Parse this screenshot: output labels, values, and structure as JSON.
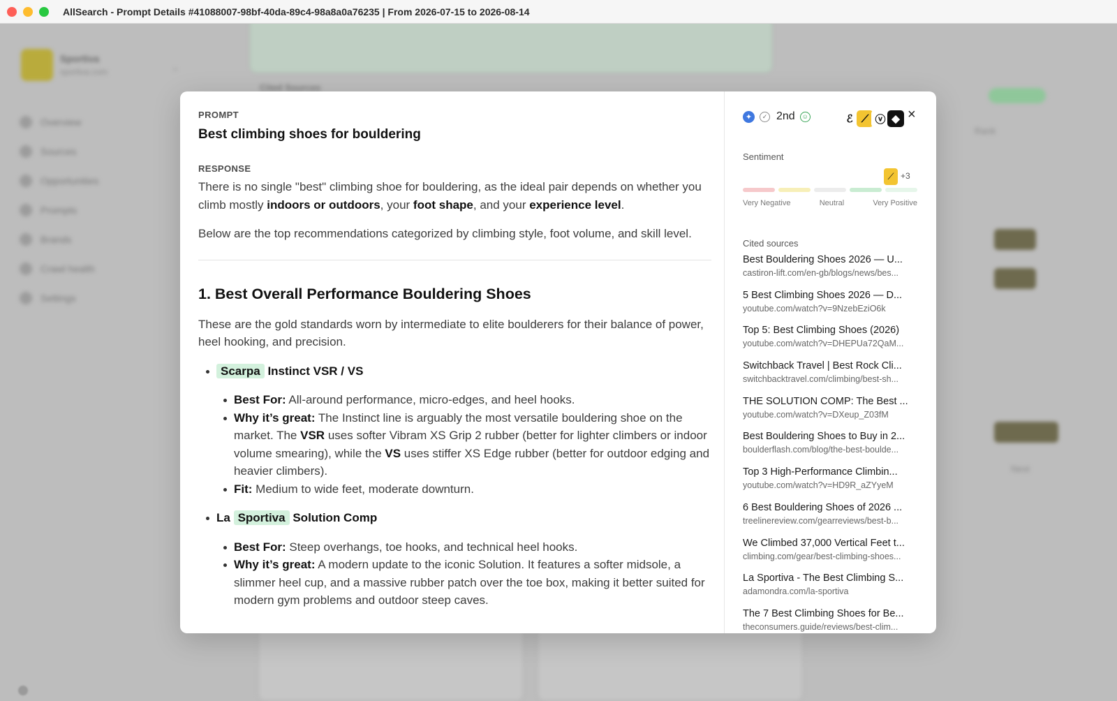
{
  "window": {
    "title": "AllSearch - Prompt Details #41088007-98bf-40da-89c4-98a8a0a76235 | From 2026-07-15 to 2026-08-14"
  },
  "background": {
    "brand_name": "Sportiva",
    "brand_sub": "sportiva.com",
    "nav": [
      "Overview",
      "Sources",
      "Opportunities",
      "Prompts",
      "Brands",
      "Crawl health",
      "Settings"
    ],
    "cited_heading": "Cited Sources",
    "rank_col": "Rank",
    "next": "Next"
  },
  "prompt": {
    "label": "PROMPT",
    "text": "Best climbing shoes for bouldering"
  },
  "response": {
    "label": "RESPONSE",
    "p1": [
      "There is no single \"best\" climbing shoe for bouldering, as the ideal pair depends on whether you climb mostly ",
      "indoors or outdoors",
      ", your ",
      "foot shape",
      ", and your ",
      "experience level",
      "."
    ],
    "p2": "Below are the top recommendations categorized by climbing style, foot volume, and skill level.",
    "h2": "1. Best Overall Performance Bouldering Shoes",
    "p3": "These are the gold standards worn by intermediate to elite boulderers for their balance of power, heel hooking, and precision.",
    "items": [
      {
        "prefix": "",
        "brand": "Scarpa",
        "suffix": "Instinct VSR / VS",
        "best_for_label": "Best For:",
        "best_for": "All-around performance, micro-edges, and heel hooks.",
        "why_label": "Why it’s great:",
        "why": [
          "The Instinct line is arguably the most versatile bouldering shoe on the market. The ",
          "VSR",
          " uses softer Vibram XS Grip 2 rubber (better for lighter climbers or indoor volume smearing), while the ",
          "VS",
          " uses stiffer XS Edge rubber (better for outdoor edging and heavier climbers)."
        ],
        "fit_label": "Fit:",
        "fit": "Medium to wide feet, moderate downturn."
      },
      {
        "prefix": "La",
        "brand": "Sportiva",
        "suffix": "Solution Comp",
        "best_for_label": "Best For:",
        "best_for": "Steep overhangs, toe hooks, and technical heel hooks.",
        "why_label": "Why it’s great:",
        "why": [
          "A modern update to the iconic Solution. It features a softer midsole, a slimmer heel cup, and a massive rubber patch over the toe box, making it better suited for modern gym problems and outdoor steep caves."
        ]
      }
    ]
  },
  "side": {
    "rank": "2nd",
    "close_icon": "×",
    "sentiment_label": "Sentiment",
    "sentiment_more": "+3",
    "sentiment_scale": [
      "Very Negative",
      "Neutral",
      "Very Positive"
    ],
    "sentiment_colors": [
      "#f6c9cb",
      "#f7efb8",
      "#ececec",
      "#c9ecd2",
      "#e6f6ea"
    ],
    "cited_label": "Cited sources",
    "sources": [
      {
        "title": "Best Bouldering Shoes 2026 — U...",
        "url": "castiron-lift.com/en-gb/blogs/news/bes..."
      },
      {
        "title": "5 Best Climbing Shoes 2026 — D...",
        "url": "youtube.com/watch?v=9NzebEziO6k"
      },
      {
        "title": "Top 5: Best Climbing Shoes (2026)",
        "url": "youtube.com/watch?v=DHEPUa72QaM..."
      },
      {
        "title": "Switchback Travel | Best Rock Cli...",
        "url": "switchbacktravel.com/climbing/best-sh..."
      },
      {
        "title": "THE SOLUTION COMP: The Best ...",
        "url": "youtube.com/watch?v=DXeup_Z03fM"
      },
      {
        "title": "Best Bouldering Shoes to Buy in 2...",
        "url": "boulderflash.com/blog/the-best-boulde..."
      },
      {
        "title": "Top 3 High-Performance Climbin...",
        "url": "youtube.com/watch?v=HD9R_aZYyeM"
      },
      {
        "title": "6 Best Bouldering Shoes of 2026 ...",
        "url": "treelinereview.com/gearreviews/best-b..."
      },
      {
        "title": "We Climbed 37,000 Vertical Feet t...",
        "url": "climbing.com/gear/best-climbing-shoes..."
      },
      {
        "title": "La Sportiva - The Best Climbing S...",
        "url": "adamondra.com/la-sportiva"
      },
      {
        "title": "The 7 Best Climbing Shoes for Be...",
        "url": "theconsumers.guide/reviews/best-clim..."
      }
    ]
  }
}
